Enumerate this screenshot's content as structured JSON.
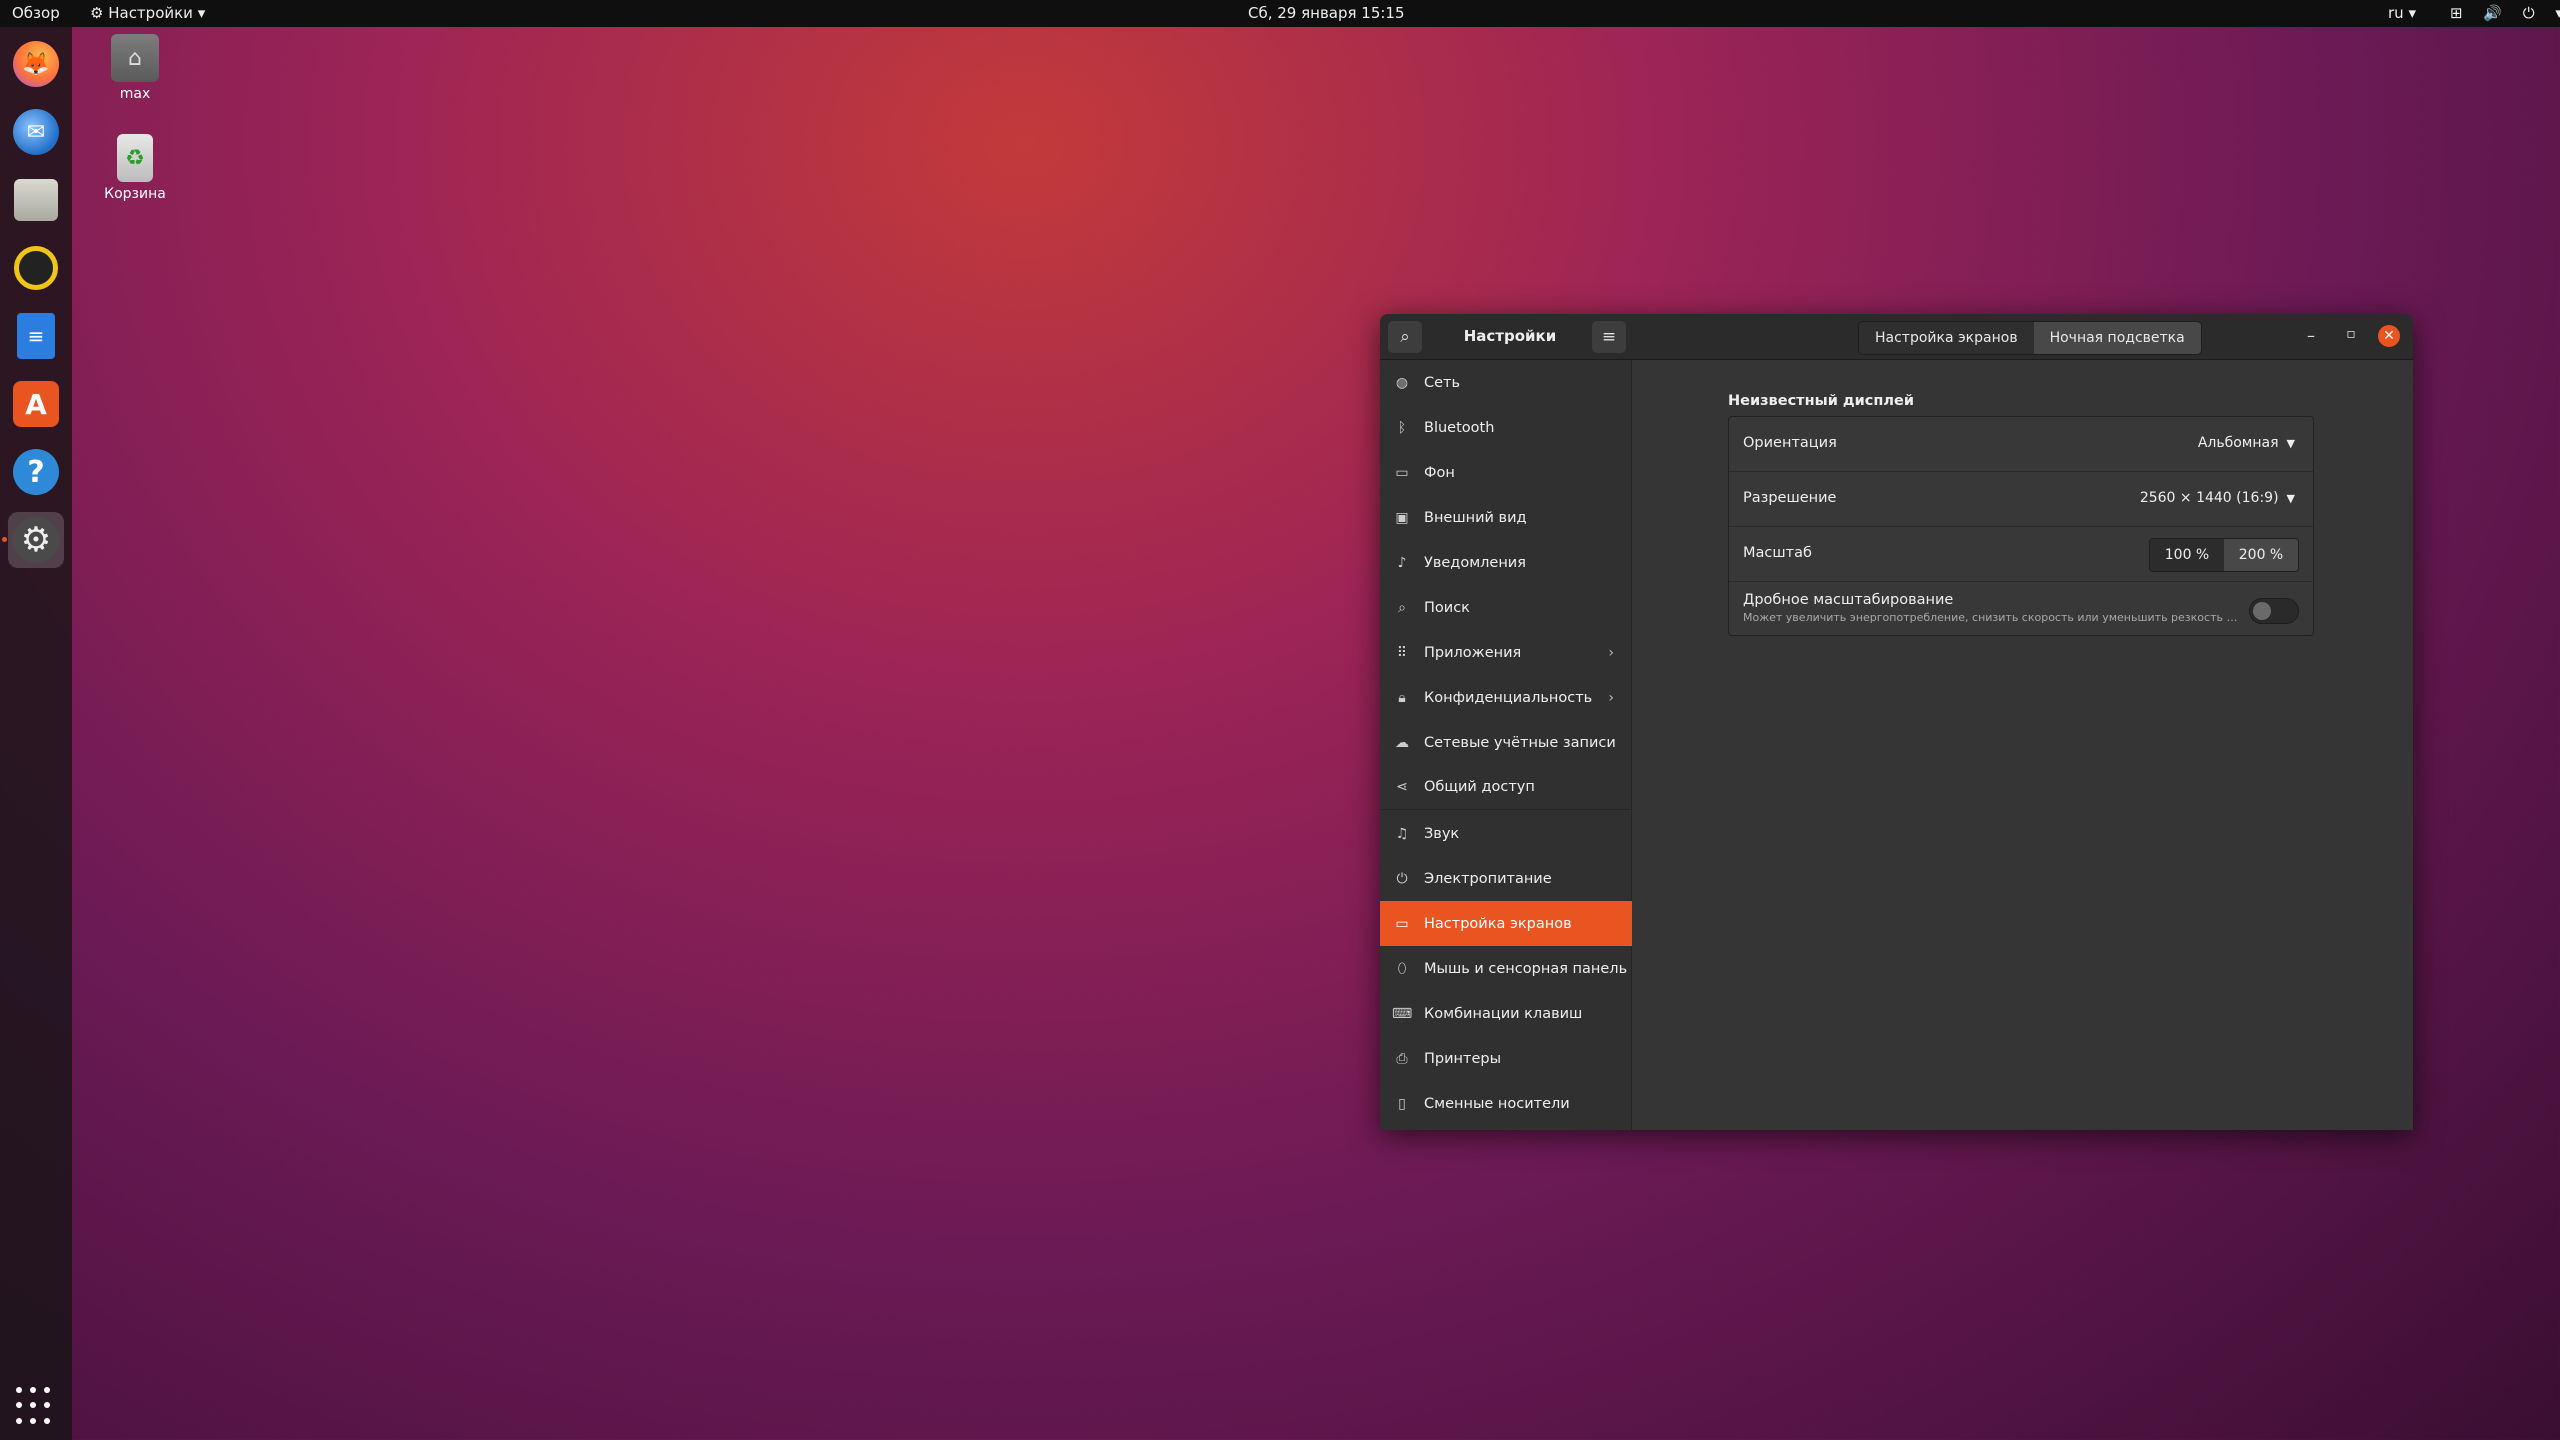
{
  "topbar": {
    "activities": "Обзор",
    "app_menu": "Настройки ▾",
    "app_menu_icon": "gear-icon",
    "clock": "Сб, 29 января  15:15",
    "lang": "ru ▾",
    "tray": "⊞ 🔊 ⏻ ▾"
  },
  "dock": {
    "items": [
      {
        "name": "firefox",
        "icon": "firefox-icon"
      },
      {
        "name": "thunderbird",
        "icon": "thunderbird-icon"
      },
      {
        "name": "files",
        "icon": "folder-icon"
      },
      {
        "name": "rhythmbox",
        "icon": "music-icon"
      },
      {
        "name": "libreoffice-writer",
        "icon": "document-icon"
      },
      {
        "name": "ubuntu-software",
        "icon": "software-icon"
      },
      {
        "name": "help",
        "icon": "help-icon"
      },
      {
        "name": "settings",
        "icon": "gear-icon",
        "active": true
      }
    ],
    "show_apps_icon": "grid-icon"
  },
  "desktop": {
    "icons": [
      {
        "label": "max",
        "icon": "home-folder-icon"
      },
      {
        "label": "Корзина",
        "icon": "trash-icon"
      }
    ]
  },
  "window": {
    "title": "Настройки",
    "tabs": [
      "Настройка экранов",
      "Ночная подсветка"
    ],
    "active_tab": "Ночная подсветка",
    "controls": {
      "minimize": "–",
      "maximize": "▫",
      "close": "✕"
    },
    "accent": "#e95420",
    "sidebar": [
      {
        "label": "Сеть",
        "icon": "network-icon"
      },
      {
        "label": "Bluetooth",
        "icon": "bluetooth-icon"
      },
      {
        "label": "Фон",
        "icon": "background-icon"
      },
      {
        "label": "Внешний вид",
        "icon": "appearance-icon"
      },
      {
        "label": "Уведомления",
        "icon": "bell-icon"
      },
      {
        "label": "Поиск",
        "icon": "search-icon"
      },
      {
        "label": "Приложения",
        "icon": "apps-icon",
        "chevron": "›"
      },
      {
        "label": "Конфиденциальность",
        "icon": "lock-icon",
        "chevron": "›"
      },
      {
        "label": "Сетевые учётные записи",
        "icon": "cloud-icon"
      },
      {
        "label": "Общий доступ",
        "icon": "share-icon"
      },
      {
        "label": "Звук",
        "icon": "music-note-icon"
      },
      {
        "label": "Электропитание",
        "icon": "power-icon"
      },
      {
        "label": "Настройка экранов",
        "icon": "display-icon",
        "selected": true
      },
      {
        "label": "Мышь и сенсорная панель",
        "icon": "mouse-icon"
      },
      {
        "label": "Комбинации клавиш",
        "icon": "keyboard-icon"
      },
      {
        "label": "Принтеры",
        "icon": "printer-icon"
      },
      {
        "label": "Сменные носители",
        "icon": "removable-media-icon"
      }
    ],
    "display": {
      "title": "Неизвестный дисплей",
      "orientation_label": "Ориентация",
      "orientation_value": "Альбомная",
      "resolution_label": "Разрешение",
      "resolution_value": "2560 × 1440 (16:9)",
      "scale_label": "Масштаб",
      "scale_options": [
        "100 %",
        "200 %"
      ],
      "scale_selected": "200 %",
      "fractional_label": "Дробное масштабирование",
      "fractional_desc": "Может увеличить энергопотребление, снизить скорость или уменьшить резкость дис…",
      "fractional_on": false
    }
  }
}
